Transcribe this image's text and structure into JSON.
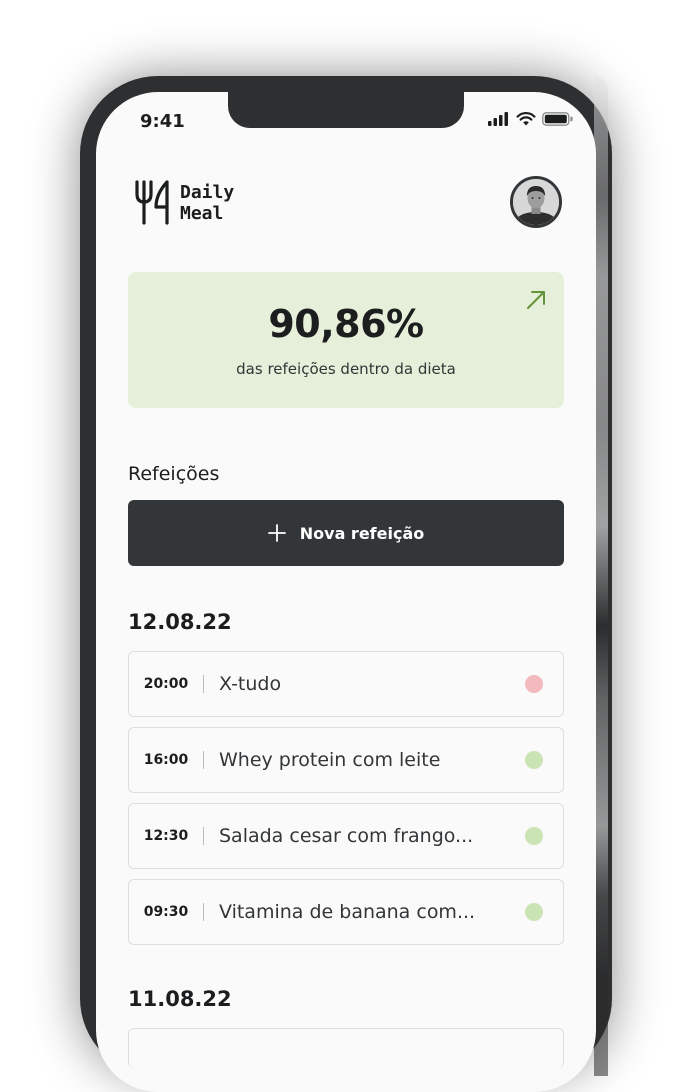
{
  "status_bar": {
    "time": "9:41"
  },
  "brand": {
    "name_line1": "Daily",
    "name_line2": "Meal"
  },
  "summary": {
    "percent": "90,86%",
    "description": "das refeições dentro da dieta"
  },
  "meals_section": {
    "title": "Refeições",
    "new_button_label": "Nova refeição"
  },
  "colors": {
    "in_diet": "#cbe4b4",
    "off_diet": "#f3babd",
    "card_bg": "#e5efd9",
    "button_bg": "#333638",
    "accent_green": "#639339"
  },
  "days": [
    {
      "date": "12.08.22",
      "meals": [
        {
          "time": "20:00",
          "name": "X-tudo",
          "in_diet": false
        },
        {
          "time": "16:00",
          "name": "Whey protein com leite",
          "in_diet": true
        },
        {
          "time": "12:30",
          "name": "Salada cesar com frango...",
          "in_diet": true
        },
        {
          "time": "09:30",
          "name": "Vitamina de banana com...",
          "in_diet": true
        }
      ]
    },
    {
      "date": "11.08.22",
      "meals": []
    }
  ]
}
